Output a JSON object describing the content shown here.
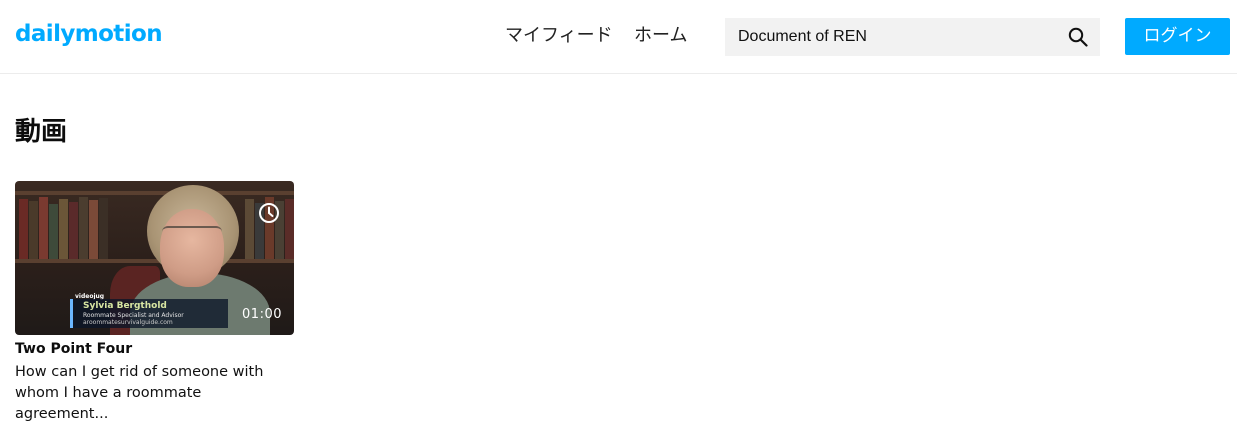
{
  "header": {
    "logo": "dailymotion",
    "nav": [
      "マイフィード",
      "ホーム"
    ],
    "search_value": "Document of REN",
    "login_label": "ログイン"
  },
  "section": {
    "title": "動画"
  },
  "videos": [
    {
      "thumbnail_caption": {
        "brand": "videojug",
        "name": "Sylvia Bergthold",
        "subtitle": "Roommate Specialist and Advisor",
        "website": "aroommatesurvivalguide.com"
      },
      "duration": "01:00",
      "owner": "Two Point Four",
      "description_line1": "How can I get rid of someone with",
      "description_line2": "whom I have a roommate agreement..."
    }
  ],
  "colors": {
    "brand": "#00aaff",
    "search_bg": "#f2f2f2"
  }
}
